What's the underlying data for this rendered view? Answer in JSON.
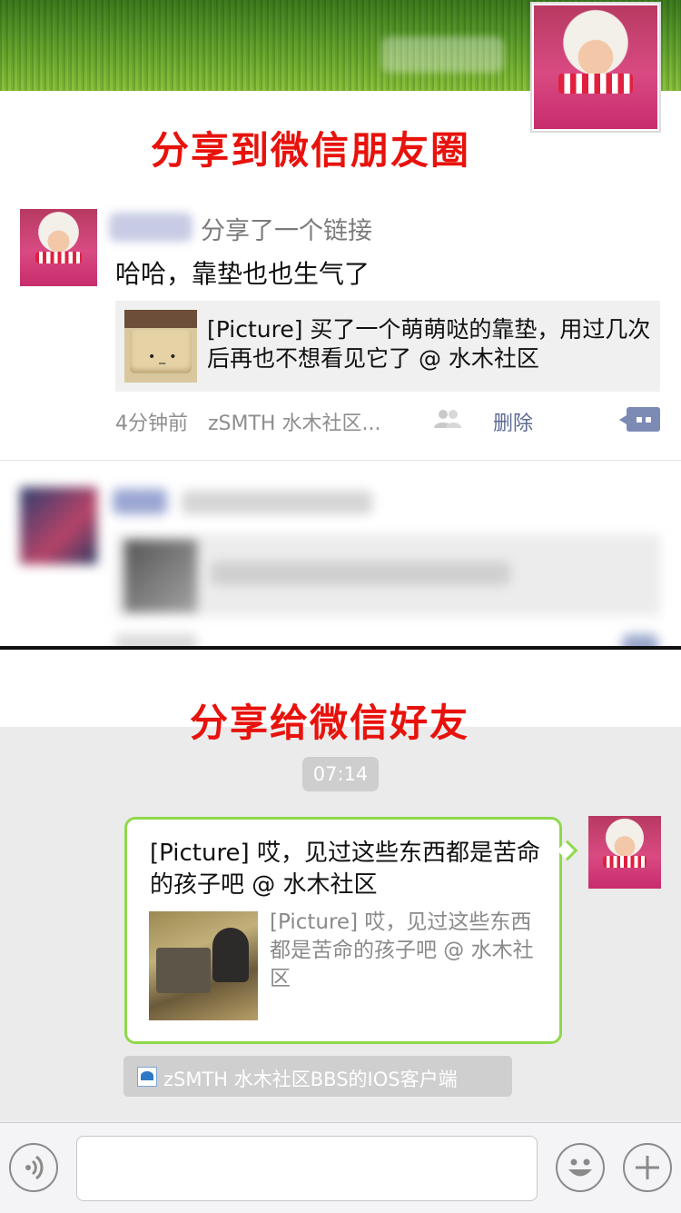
{
  "moments": {
    "heading": "分享到微信朋友圈",
    "post": {
      "action": "分享了一个链接",
      "text": "哈哈，靠垫也也生气了",
      "link_text": "[Picture] 买了一个萌萌哒的靠垫，用过几次后再也不想看见它了 @ 水木社区",
      "time": "4分钟前",
      "source": "zSMTH 水木社区...",
      "delete_label": "删除"
    }
  },
  "chat": {
    "heading": "分享给微信好友",
    "time": "07:14",
    "message": {
      "title": "[Picture] 哎，见过这些东西都是苦命的孩子吧 @ 水木社区",
      "desc": "[Picture] 哎，见过这些东西都是苦命的孩子吧 @ 水木社区"
    },
    "source_label": "zSMTH 水木社区BBS的IOS客户端"
  },
  "colors": {
    "heading_red": "#e8120c",
    "bubble_border": "#8fd94d",
    "link_blue": "#5b6a92"
  },
  "icons": {
    "voice": "voice-icon",
    "emoji": "emoji-icon",
    "plus": "plus-icon",
    "friends": "friends-icon",
    "comment": "comment-icon"
  }
}
